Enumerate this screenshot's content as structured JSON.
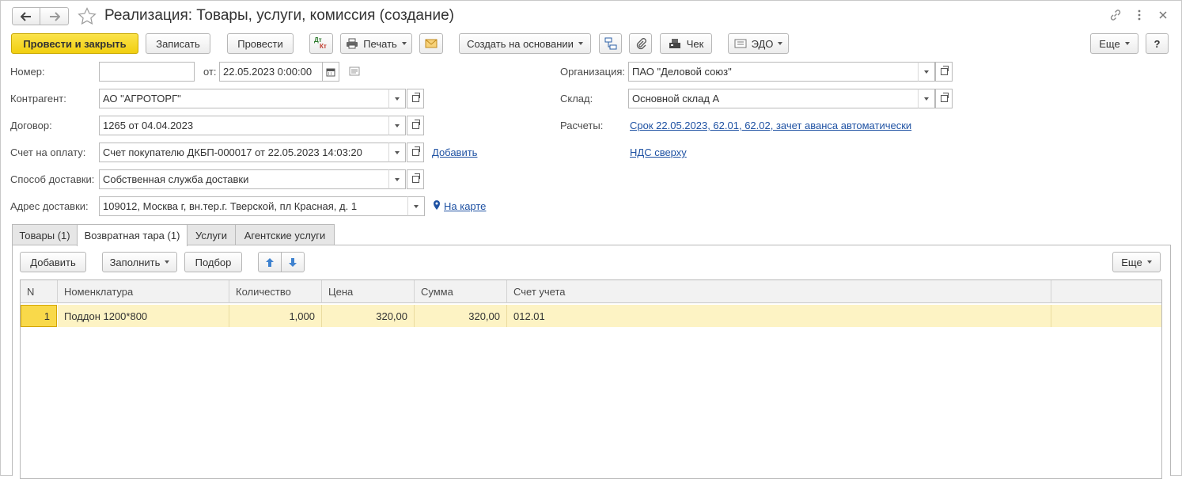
{
  "window": {
    "title": "Реализация: Товары, услуги, комиссия (создание)"
  },
  "toolbar": {
    "post_close": "Провести и закрыть",
    "save": "Записать",
    "post": "Провести",
    "dt_icon_top": "Дт",
    "dt_icon_bottom": "Кт",
    "print": "Печать",
    "create_based": "Создать на основании",
    "receipt": "Чек",
    "edo": "ЭДО",
    "more": "Еще",
    "help": "?"
  },
  "form": {
    "number_label": "Номер:",
    "number_value": "",
    "from_label": "от:",
    "date_value": "22.05.2023  0:00:00",
    "contractor_label": "Контрагент:",
    "contractor_value": "АО \"АГРОТОРГ\"",
    "contract_label": "Договор:",
    "contract_value": "1265 от 04.04.2023",
    "invoice_label": "Счет на оплату:",
    "invoice_value": "Счет покупателю ДКБП-000017 от 22.05.2023 14:03:20",
    "invoice_add": "Добавить",
    "delivery_method_label": "Способ доставки:",
    "delivery_method_value": "Собственная служба доставки",
    "delivery_address_label": "Адрес доставки:",
    "delivery_address_value": "109012, Москва г, вн.тер.г. Тверской, пл Красная, д. 1",
    "on_map": "На карте",
    "org_label": "Организация:",
    "org_value": "ПАО \"Деловой союз\"",
    "warehouse_label": "Склад:",
    "warehouse_value": "Основной склад А",
    "settlements_label": "Расчеты:",
    "settlements_link": "Срок 22.05.2023, 62.01, 62.02, зачет аванса автоматически",
    "vat_link": "НДС сверху"
  },
  "tabs": [
    {
      "label": "Товары (1)"
    },
    {
      "label": "Возвратная тара (1)"
    },
    {
      "label": "Услуги"
    },
    {
      "label": "Агентские услуги"
    }
  ],
  "table_toolbar": {
    "add": "Добавить",
    "fill": "Заполнить",
    "pick": "Подбор",
    "more": "Еще"
  },
  "table": {
    "columns": [
      "N",
      "Номенклатура",
      "Количество",
      "Цена",
      "Сумма",
      "Счет учета"
    ],
    "rows": [
      {
        "n": "1",
        "item": "Поддон 1200*800",
        "qty": "1,000",
        "price": "320,00",
        "sum": "320,00",
        "account": "012.01"
      }
    ]
  }
}
